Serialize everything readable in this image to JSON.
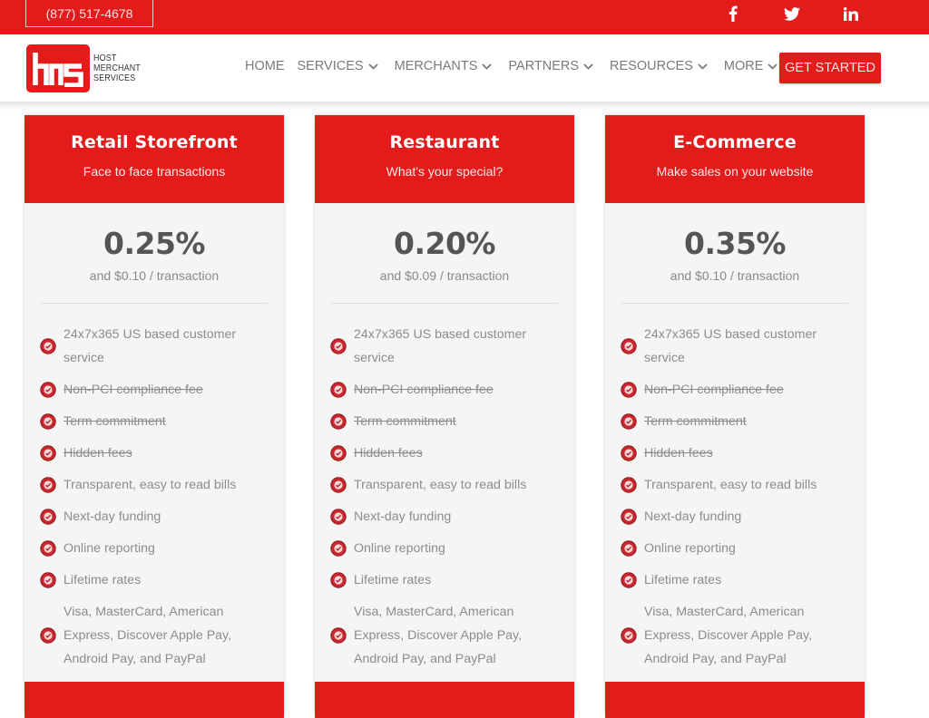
{
  "topbar": {
    "phone": "(877) 517-4678",
    "social": [
      {
        "name": "facebook-icon",
        "label": "Facebook"
      },
      {
        "name": "twitter-icon",
        "label": "Twitter"
      },
      {
        "name": "linkedin-icon",
        "label": "LinkedIn"
      }
    ]
  },
  "header": {
    "logo": {
      "line1": "HOST",
      "line2": "MERCHANT",
      "line3": "SERVICES"
    },
    "nav": [
      {
        "label": "HOME",
        "dropdown": false
      },
      {
        "label": "SERVICES",
        "dropdown": true
      },
      {
        "label": "MERCHANTS",
        "dropdown": true
      },
      {
        "label": "PARTNERS",
        "dropdown": true
      },
      {
        "label": "RESOURCES",
        "dropdown": true
      },
      {
        "label": "MORE",
        "dropdown": true
      }
    ],
    "cta": "GET STARTED"
  },
  "colors": {
    "brand_red": "#e41b1b",
    "text_gray": "#8c8c8c",
    "price_gray": "#555555",
    "card_bg": "#f5f5f5"
  },
  "plans": [
    {
      "title": "Retail Storefront",
      "subtitle": "Face to face transactions",
      "rate": "0.25%",
      "per_transaction": "and $0.10 / transaction",
      "features": [
        {
          "text": "24x7x365 US based customer service",
          "strike": false
        },
        {
          "text": "Non-PCI compliance fee",
          "strike": true
        },
        {
          "text": "Term commitment",
          "strike": true
        },
        {
          "text": "Hidden fees",
          "strike": true
        },
        {
          "text": "Transparent, easy to read bills",
          "strike": false
        },
        {
          "text": "Next-day funding",
          "strike": false
        },
        {
          "text": "Online reporting",
          "strike": false
        },
        {
          "text": "Lifetime rates",
          "strike": false
        },
        {
          "text": "Visa, MasterCard, American Express, Discover Apple Pay, Android Pay, and PayPal",
          "strike": false
        }
      ]
    },
    {
      "title": "Restaurant",
      "subtitle": "What's your special?",
      "rate": "0.20%",
      "per_transaction": "and $0.09 / transaction",
      "features": [
        {
          "text": "24x7x365 US based customer service",
          "strike": false
        },
        {
          "text": "Non-PCI compliance fee",
          "strike": true
        },
        {
          "text": "Term commitment",
          "strike": true
        },
        {
          "text": "Hidden fees",
          "strike": true
        },
        {
          "text": "Transparent, easy to read bills",
          "strike": false
        },
        {
          "text": "Next-day funding",
          "strike": false
        },
        {
          "text": "Online reporting",
          "strike": false
        },
        {
          "text": "Lifetime rates",
          "strike": false
        },
        {
          "text": "Visa, MasterCard, American Express, Discover Apple Pay, Android Pay, and PayPal",
          "strike": false
        }
      ]
    },
    {
      "title": "E-Commerce",
      "subtitle": "Make sales on your website",
      "rate": "0.35%",
      "per_transaction": "and $0.10 / transaction",
      "features": [
        {
          "text": "24x7x365 US based customer service",
          "strike": false
        },
        {
          "text": "Non-PCI compliance fee",
          "strike": true
        },
        {
          "text": "Term commitment",
          "strike": true
        },
        {
          "text": "Hidden fees",
          "strike": true
        },
        {
          "text": "Transparent, easy to read bills",
          "strike": false
        },
        {
          "text": "Next-day funding",
          "strike": false
        },
        {
          "text": "Online reporting",
          "strike": false
        },
        {
          "text": "Lifetime rates",
          "strike": false
        },
        {
          "text": "Visa, MasterCard, American Express, Discover Apple Pay, Android Pay, and PayPal",
          "strike": false
        }
      ]
    }
  ]
}
